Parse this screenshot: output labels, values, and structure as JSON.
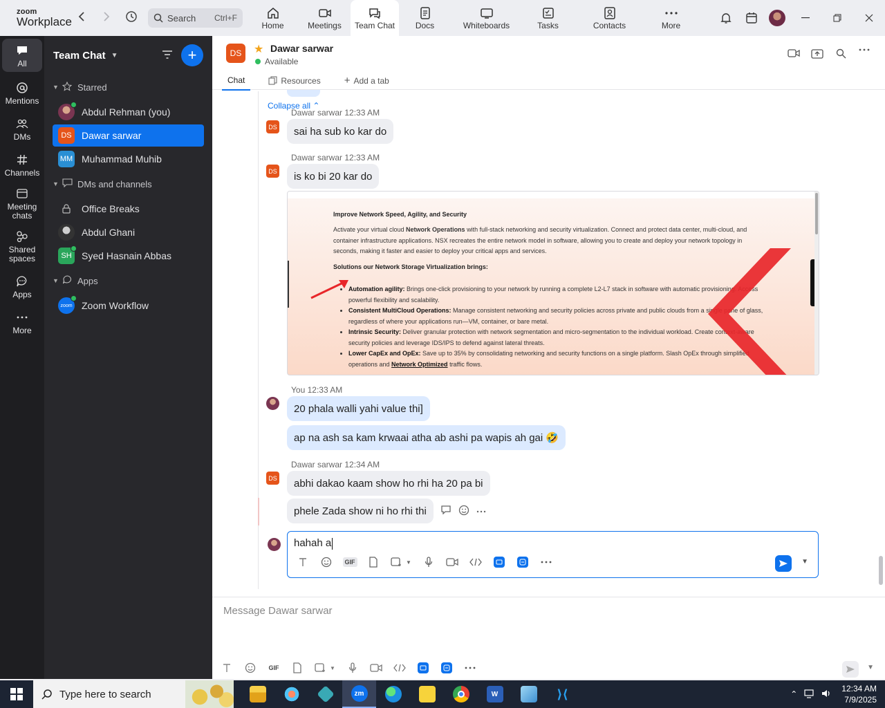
{
  "app": {
    "logo_line1": "zoom",
    "logo_line2": "Workplace"
  },
  "search": {
    "label": "Search",
    "shortcut": "Ctrl+F"
  },
  "tabs": [
    {
      "label": "Home",
      "icon": "home-icon"
    },
    {
      "label": "Meetings",
      "icon": "video-icon"
    },
    {
      "label": "Team Chat",
      "icon": "chat-icon"
    },
    {
      "label": "Docs",
      "icon": "doc-icon"
    },
    {
      "label": "Whiteboards",
      "icon": "whiteboard-icon"
    },
    {
      "label": "Tasks",
      "icon": "tasks-icon"
    },
    {
      "label": "Contacts",
      "icon": "contacts-icon"
    },
    {
      "label": "More",
      "icon": "more-icon"
    }
  ],
  "rail": [
    {
      "label": "All"
    },
    {
      "label": "Mentions"
    },
    {
      "label": "DMs"
    },
    {
      "label": "Channels"
    },
    {
      "label": "Meeting chats"
    },
    {
      "label": "Shared spaces"
    },
    {
      "label": "Apps"
    },
    {
      "label": "More"
    }
  ],
  "sidebar": {
    "title": "Team Chat",
    "sections": {
      "starred": "Starred",
      "dms": "DMs and channels",
      "apps": "Apps"
    },
    "starred_items": [
      {
        "label": "Abdul Rehman (you)",
        "avatar": ""
      },
      {
        "label": "Dawar sarwar",
        "avatar": "DS"
      },
      {
        "label": "Muhammad Muhib",
        "avatar": "MM"
      }
    ],
    "dm_items": [
      {
        "label": "Office Breaks",
        "avatar": ""
      },
      {
        "label": "Abdul Ghani",
        "avatar": ""
      },
      {
        "label": "Syed Hasnain Abbas",
        "avatar": "SH"
      }
    ],
    "app_items": [
      {
        "label": "Zoom Workflow",
        "avatar": "zoom"
      }
    ]
  },
  "channel": {
    "avatar": "DS",
    "name": "Dawar sarwar",
    "status": "Available",
    "tabs": {
      "chat": "Chat",
      "resources": "Resources",
      "add": "Add a tab"
    }
  },
  "thread": {
    "collapse": "Collapse all",
    "messages": [
      {
        "sender": "Dawar sarwar",
        "time": "12:33 AM",
        "text": "sai ha sub ko kar do"
      },
      {
        "sender": "Dawar sarwar",
        "time": "12:33 AM",
        "text": "is ko bi 20 kar do"
      },
      {
        "sender": "You",
        "time": "12:33 AM",
        "text": "20 phala walli yahi value thi]"
      },
      {
        "sender": "",
        "time": "",
        "text": "ap na ash sa kam krwaai atha ab ashi pa wapis ah gai 🤣"
      },
      {
        "sender": "Dawar sarwar",
        "time": "12:34 AM",
        "text": "abhi dakao kaam show ho rhi ha 20 pa bi"
      },
      {
        "sender": "",
        "time": "",
        "text": "phele Zada show ni ho rhi thi"
      }
    ]
  },
  "screenshot": {
    "heading": "Improve Network Speed, Agility, and Security",
    "intro_pre": "Activate your virtual cloud ",
    "intro_bold": "Network Operations",
    "intro_post": " with full-stack networking and security virtualization. Connect and protect data center, multi-cloud, and container infrastructure applications. NSX recreates the entire network model in software, allowing you to create and deploy your network topology in seconds, making it faster and easier to deploy your critical apps and services.",
    "subheading": "Solutions our Network Storage Virtualization brings:",
    "bullets": [
      {
        "title": "Automation agility:",
        "text": " Brings one-click provisioning to your network by running a complete L2-L7 stack in software with automatic provisioning. Access powerful flexibility and scalability."
      },
      {
        "title": "Consistent MultiCloud Operations:",
        "text": " Manage consistent networking and security policies across private and public clouds from a single pane of glass, regardless of where your applications run—VM, container, or bare metal."
      },
      {
        "title": "Intrinsic Security:",
        "text": " Deliver granular protection with network segmentation and micro-segmentation to the individual workload. Create context-aware security policies and leverage IDS/IPS to defend against lateral threats."
      },
      {
        "title": "Lower CapEx and OpEx:",
        "text": " Save up to 35% by consolidating networking and security functions on a single platform. Slash OpEx through simplified operations and ",
        "link": "Network Optimized",
        "tail": " traffic flows."
      }
    ]
  },
  "reply": {
    "value": "hahah a",
    "gif": "GIF"
  },
  "composer": {
    "placeholder": "Message Dawar sarwar",
    "gif": "GIF"
  },
  "taskbar": {
    "search_placeholder": "Type here to search",
    "time": "12:34 AM",
    "date": "7/9/2025",
    "zoom_label": "zm"
  },
  "colors": {
    "accent": "#0e72ed",
    "ds_avatar": "#e5541a",
    "online": "#2fbe5f"
  }
}
